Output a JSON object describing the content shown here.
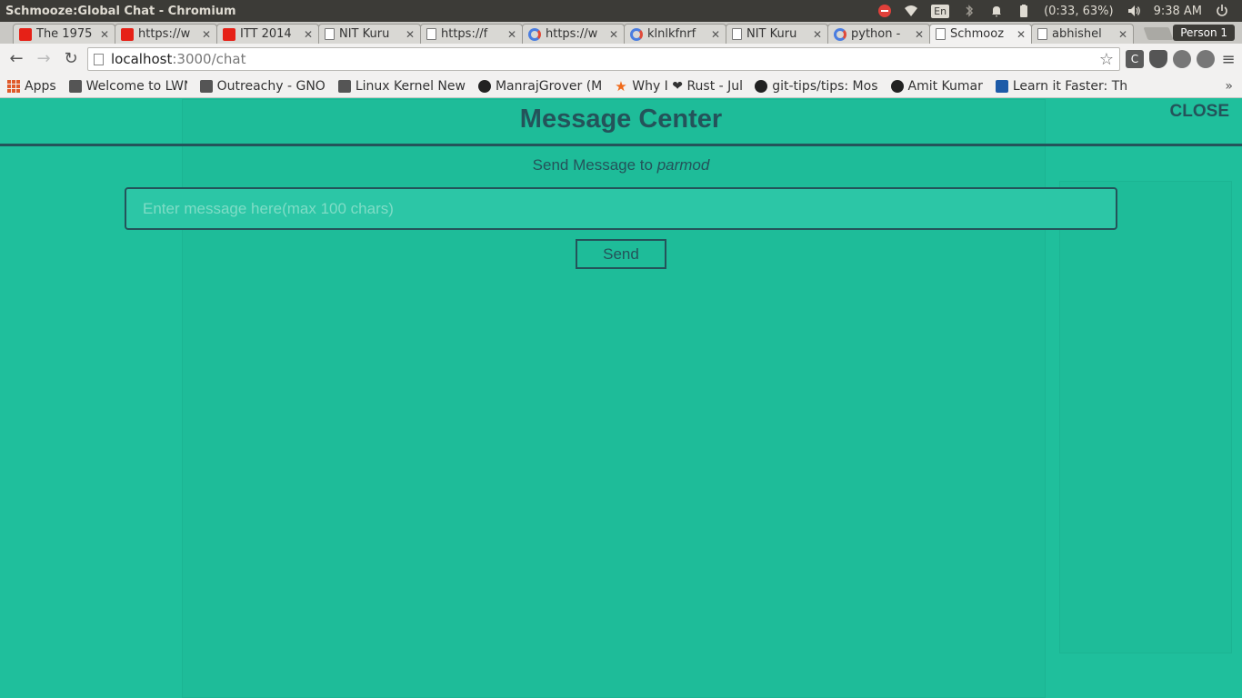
{
  "os_bar": {
    "window_title": "Schmooze:Global Chat - Chromium",
    "language": "En",
    "battery": "(0:33, 63%)",
    "time": "9:38 AM"
  },
  "tabs": [
    {
      "label": "The 1975",
      "icon": "youtube-icon"
    },
    {
      "label": "https://w",
      "icon": "youtube-icon"
    },
    {
      "label": "ITT 2014",
      "icon": "youtube-icon"
    },
    {
      "label": "NIT Kuru",
      "icon": "page-icon"
    },
    {
      "label": "https://f",
      "icon": "page-icon"
    },
    {
      "label": "https://w",
      "icon": "google-icon"
    },
    {
      "label": "klnlkfnrf",
      "icon": "google-icon"
    },
    {
      "label": "NIT Kuru",
      "icon": "page-icon"
    },
    {
      "label": "python -",
      "icon": "google-icon"
    },
    {
      "label": "Schmooz",
      "icon": "page-icon",
      "active": true
    },
    {
      "label": "abhishel",
      "icon": "page-icon"
    }
  ],
  "profile": {
    "label": "Person 1"
  },
  "address_bar": {
    "host": "localhost",
    "path": ":3000/chat"
  },
  "extensions": {
    "c_label": "C"
  },
  "bookmarks": [
    {
      "label": "Apps",
      "icon": "apps-grid-icon"
    },
    {
      "label": "Welcome to LWN",
      "icon": "penguin-icon"
    },
    {
      "label": "Outreachy - GNO",
      "icon": "gnome-icon"
    },
    {
      "label": "Linux Kernel New",
      "icon": "kernel-icon"
    },
    {
      "label": "ManrajGrover (M",
      "icon": "github-icon"
    },
    {
      "label": "Why I ❤ Rust - Jul",
      "icon": "star-icon"
    },
    {
      "label": "git-tips/tips: Mos",
      "icon": "github-icon"
    },
    {
      "label": "Amit Kumar",
      "icon": "code-icon"
    },
    {
      "label": "Learn it Faster: Th",
      "icon": "learn-icon"
    }
  ],
  "modal": {
    "title": "Message Center",
    "close_label": "CLOSE",
    "send_to_prefix": "Send Message to",
    "recipient": "parmod",
    "input_placeholder": "Enter message here(max 100 chars)",
    "input_value": "",
    "send_label": "Send"
  },
  "colors": {
    "background": "#1fbf9c",
    "accent_dark": "#24535a"
  }
}
